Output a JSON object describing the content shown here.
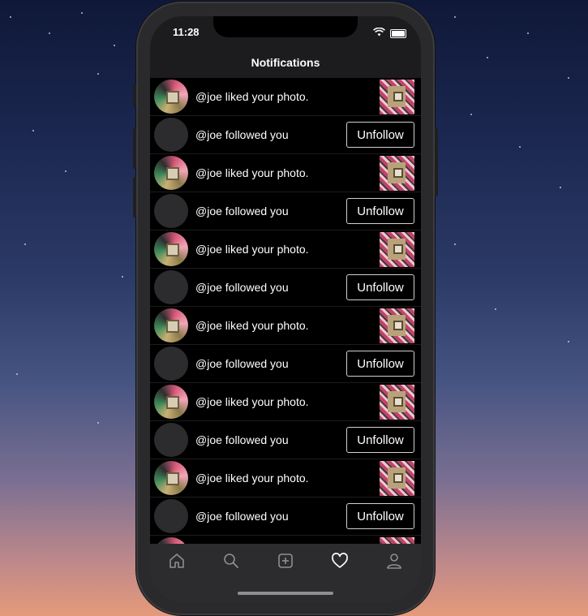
{
  "status_bar": {
    "time": "11:28"
  },
  "header": {
    "title": "Notifications"
  },
  "notifications": [
    {
      "type": "like",
      "text": "@joe liked your photo."
    },
    {
      "type": "follow",
      "text": "@joe followed you",
      "button": "Unfollow"
    },
    {
      "type": "like",
      "text": "@joe liked your photo."
    },
    {
      "type": "follow",
      "text": "@joe followed you",
      "button": "Unfollow"
    },
    {
      "type": "like",
      "text": "@joe liked your photo."
    },
    {
      "type": "follow",
      "text": "@joe followed you",
      "button": "Unfollow"
    },
    {
      "type": "like",
      "text": "@joe liked your photo."
    },
    {
      "type": "follow",
      "text": "@joe followed you",
      "button": "Unfollow"
    },
    {
      "type": "like",
      "text": "@joe liked your photo."
    },
    {
      "type": "follow",
      "text": "@joe followed you",
      "button": "Unfollow"
    },
    {
      "type": "like",
      "text": "@joe liked your photo."
    },
    {
      "type": "follow",
      "text": "@joe followed you",
      "button": "Unfollow"
    },
    {
      "type": "like",
      "text": ""
    }
  ],
  "tabbar": {
    "tabs": [
      {
        "name": "home",
        "icon": "home-icon",
        "active": false
      },
      {
        "name": "search",
        "icon": "search-icon",
        "active": false
      },
      {
        "name": "add",
        "icon": "add-post-icon",
        "active": false
      },
      {
        "name": "notifications",
        "icon": "heart-icon",
        "active": true
      },
      {
        "name": "profile",
        "icon": "person-icon",
        "active": false
      }
    ]
  },
  "colors": {
    "background": "#000000",
    "tabbar": "#2c2c2e",
    "inactive_icon": "#8e8e93",
    "active_icon": "#ffffff"
  }
}
